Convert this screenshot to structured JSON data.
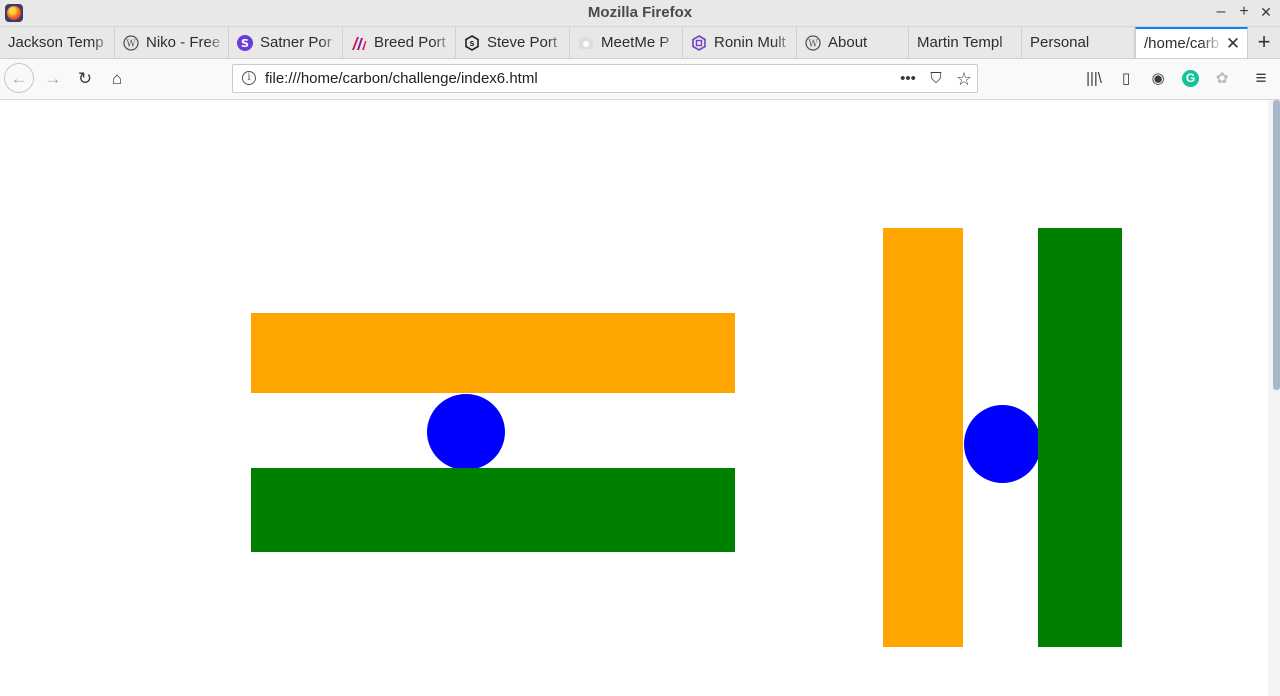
{
  "window": {
    "title": "Mozilla Firefox",
    "controls": {
      "minimize": "–",
      "maximize": "+",
      "close": "✕"
    }
  },
  "tabs": [
    {
      "label": "Jackson Temp",
      "favicon": "none",
      "active": false
    },
    {
      "label": "Niko - Free",
      "favicon": "wordpress-icon",
      "active": false
    },
    {
      "label": "Satner Por",
      "favicon": "satner-s-icon",
      "active": false
    },
    {
      "label": "Breed Port",
      "favicon": "breed-logo-icon",
      "active": false
    },
    {
      "label": "Steve Port",
      "favicon": "hexagon-icon",
      "active": false
    },
    {
      "label": "MeetMe P",
      "favicon": "camera-icon",
      "active": false
    },
    {
      "label": "Ronin Mult",
      "favicon": "bootstrap-icon",
      "active": false
    },
    {
      "label": "About",
      "favicon": "wordpress-icon",
      "active": false
    },
    {
      "label": "Martin Templ",
      "favicon": "none",
      "active": false
    },
    {
      "label": "Personal",
      "favicon": "none",
      "active": false
    },
    {
      "label": "/home/carb",
      "favicon": "none",
      "active": true
    }
  ],
  "new_tab": "+",
  "nav": {
    "back": "←",
    "forward": "→",
    "reload": "↻",
    "home": "⌂"
  },
  "urlbar": {
    "info": "i",
    "url": "file:///home/carbon/challenge/index6.html",
    "page_actions": "•••",
    "pocket": "⛉",
    "bookmark": "☆"
  },
  "toolbar": {
    "library": "|||\\",
    "sidebar": "▯",
    "extension1": "◉",
    "grammarly": "G",
    "extension2": "✿",
    "menu": "≡"
  },
  "colors": {
    "saffron": "#FFA500",
    "green": "#008000",
    "chakra": "#0000FF",
    "accent": "#0A84FF"
  }
}
